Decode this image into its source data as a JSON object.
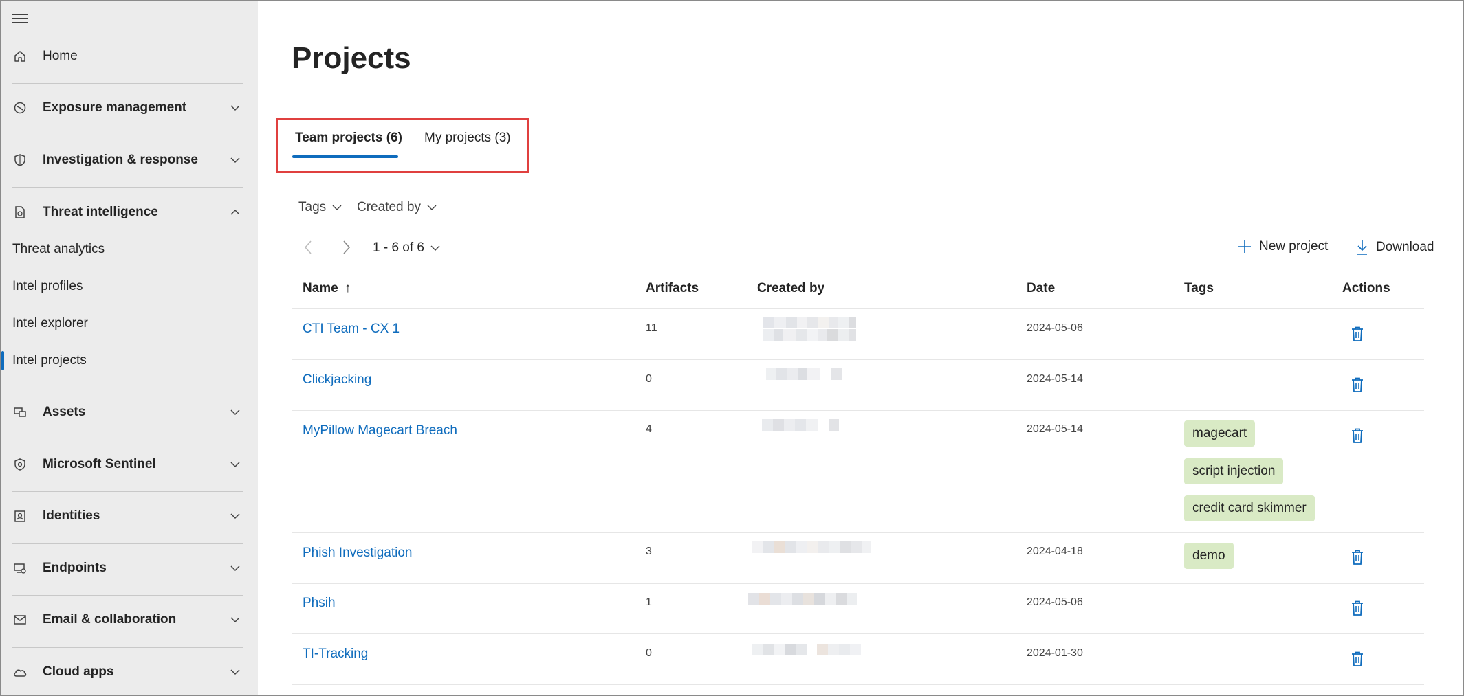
{
  "sidebar": {
    "home": "Home",
    "sections": [
      {
        "label": "Exposure management",
        "icon": "exposure-icon"
      },
      {
        "label": "Investigation & response",
        "icon": "shield-icon"
      },
      {
        "label": "Threat intelligence",
        "icon": "threat-intel-icon"
      },
      {
        "label": "Assets",
        "icon": "assets-icon"
      },
      {
        "label": "Microsoft Sentinel",
        "icon": "sentinel-icon"
      },
      {
        "label": "Identities",
        "icon": "identity-icon"
      },
      {
        "label": "Endpoints",
        "icon": "endpoint-icon"
      },
      {
        "label": "Email & collaboration",
        "icon": "mail-icon"
      },
      {
        "label": "Cloud apps",
        "icon": "cloud-icon"
      }
    ],
    "threat_intel_items": [
      "Threat analytics",
      "Intel profiles",
      "Intel explorer",
      "Intel projects"
    ],
    "active_item": "Intel projects"
  },
  "page": {
    "title": "Projects",
    "tabs": [
      {
        "label": "Team projects (6)",
        "active": true
      },
      {
        "label": "My projects (3)",
        "active": false
      }
    ],
    "filters": [
      "Tags",
      "Created by"
    ],
    "pager": {
      "range": "1 - 6 of 6"
    },
    "commands": {
      "new_project": "New project",
      "download": "Download"
    }
  },
  "table": {
    "columns": {
      "name": "Name",
      "sort_arrow": "↑",
      "artifacts": "Artifacts",
      "created_by": "Created by",
      "date": "Date",
      "tags": "Tags",
      "actions": "Actions"
    },
    "rows": [
      {
        "name": "CTI Team - CX 1",
        "artifacts": "11",
        "date": "2024-05-06",
        "tags": []
      },
      {
        "name": "Clickjacking",
        "artifacts": "0",
        "date": "2024-05-14",
        "tags": []
      },
      {
        "name": "MyPillow Magecart Breach",
        "artifacts": "4",
        "date": "2024-05-14",
        "tags": [
          "magecart",
          "script injection",
          "credit card skimmer"
        ]
      },
      {
        "name": "Phish Investigation",
        "artifacts": "3",
        "date": "2024-04-18",
        "tags": [
          "demo"
        ]
      },
      {
        "name": "Phsih",
        "artifacts": "1",
        "date": "2024-05-06",
        "tags": []
      },
      {
        "name": "TI-Tracking",
        "artifacts": "0",
        "date": "2024-01-30",
        "tags": []
      }
    ]
  },
  "colors": {
    "accent": "#0f6cbd",
    "highlight": "#e0403f",
    "tag_bg": "#d9eac5",
    "sidebar_bg": "#ececec"
  }
}
